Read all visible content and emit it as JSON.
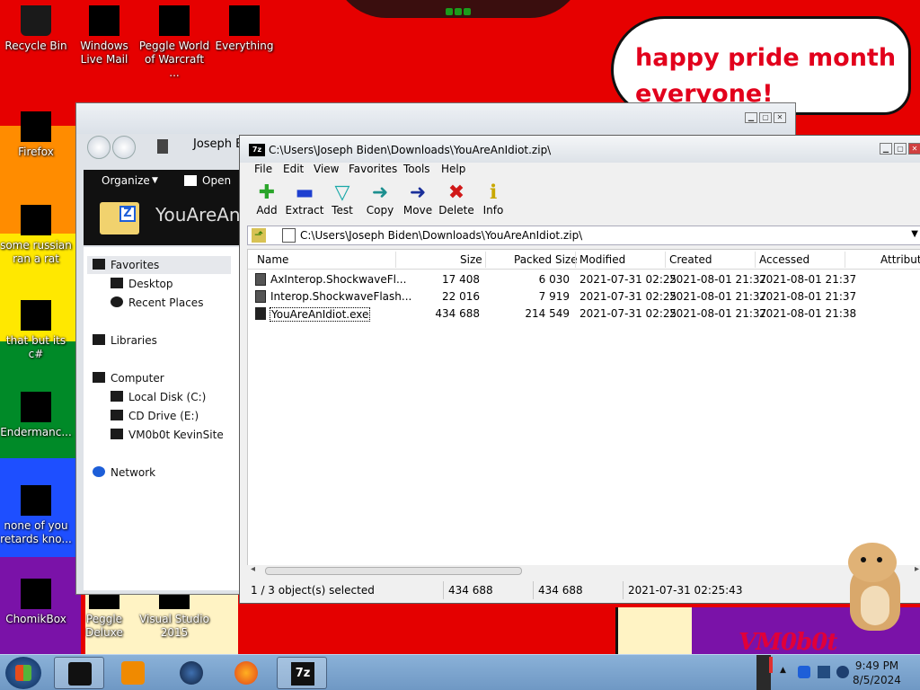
{
  "desktop": {
    "bubble_text": "happy pride month everyone!",
    "watermark": "VM0b0t",
    "icons": [
      {
        "label": "Recycle Bin"
      },
      {
        "label": "Windows Live Mail"
      },
      {
        "label": "Peggle World of Warcraft ..."
      },
      {
        "label": "Everything"
      },
      {
        "label": "Firefox"
      },
      {
        "label": "some russian ran a rat"
      },
      {
        "label": "that but its c#"
      },
      {
        "label": "Endermanc..."
      },
      {
        "label": "none of you retards kno..."
      },
      {
        "label": "ChomikBox"
      },
      {
        "label": "Peggle Deluxe"
      },
      {
        "label": "Visual Studio 2015"
      }
    ]
  },
  "explorer": {
    "path": "Joseph B",
    "toolbar": {
      "organize": "Organize",
      "open": "Open"
    },
    "banner_name": "YouAreAn",
    "sidebar": {
      "favorites": "Favorites",
      "desktop": "Desktop",
      "recent": "Recent Places",
      "libraries": "Libraries",
      "computer": "Computer",
      "local_disk": "Local Disk (C:)",
      "cd_drive": "CD Drive (E:)",
      "share": "VM0b0t KevinSite",
      "network": "Network"
    }
  },
  "sevenzip": {
    "title": "C:\\Users\\Joseph Biden\\Downloads\\YouAreAnIdiot.zip\\",
    "logo": "7z",
    "menu": [
      "File",
      "Edit",
      "View",
      "Favorites",
      "Tools",
      "Help"
    ],
    "toolbar": {
      "add": "Add",
      "extract": "Extract",
      "test": "Test",
      "copy": "Copy",
      "move": "Move",
      "delete": "Delete",
      "info": "Info"
    },
    "address": "C:\\Users\\Joseph Biden\\Downloads\\YouAreAnIdiot.zip\\",
    "columns": [
      "Name",
      "Size",
      "Packed Size",
      "Modified",
      "Created",
      "Accessed",
      "Attribute"
    ],
    "rows": [
      {
        "name": "AxInterop.ShockwaveFl...",
        "size": "17 408",
        "packed": "6 030",
        "modified": "2021-07-31 02:25",
        "created": "2021-08-01 21:37",
        "accessed": "2021-08-01 21:37"
      },
      {
        "name": "Interop.ShockwaveFlash...",
        "size": "22 016",
        "packed": "7 919",
        "modified": "2021-07-31 02:25",
        "created": "2021-08-01 21:37",
        "accessed": "2021-08-01 21:37"
      },
      {
        "name": "YouAreAnIdiot.exe",
        "size": "434 688",
        "packed": "214 549",
        "modified": "2021-07-31 02:25",
        "created": "2021-08-01 21:37",
        "accessed": "2021-08-01 21:38"
      }
    ],
    "status": {
      "selected": "1 / 3 object(s) selected",
      "size": "434 688",
      "packed": "434 688",
      "modified": "2021-07-31 02:25:43"
    }
  },
  "taskbar": {
    "time": "9:49 PM",
    "date": "8/5/2024"
  },
  "colors": {
    "accent_red": "#e80000",
    "taskbar": "#7fa6d0",
    "bubble_text": "#e2001c"
  }
}
